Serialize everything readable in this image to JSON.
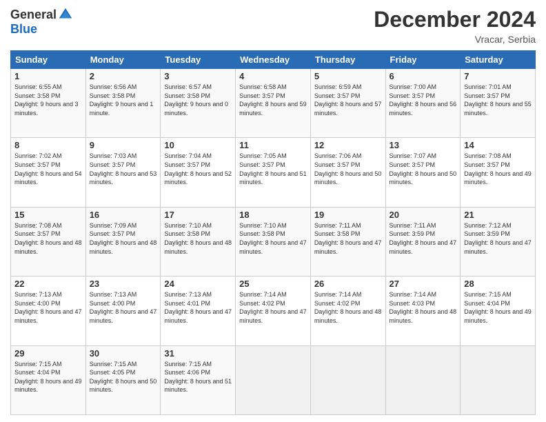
{
  "logo": {
    "general": "General",
    "blue": "Blue"
  },
  "header": {
    "month": "December 2024",
    "location": "Vracar, Serbia"
  },
  "weekdays": [
    "Sunday",
    "Monday",
    "Tuesday",
    "Wednesday",
    "Thursday",
    "Friday",
    "Saturday"
  ],
  "weeks": [
    [
      {
        "day": "1",
        "sunrise": "6:55 AM",
        "sunset": "3:58 PM",
        "daylight": "9 hours and 3 minutes."
      },
      {
        "day": "2",
        "sunrise": "6:56 AM",
        "sunset": "3:58 PM",
        "daylight": "9 hours and 1 minute."
      },
      {
        "day": "3",
        "sunrise": "6:57 AM",
        "sunset": "3:58 PM",
        "daylight": "9 hours and 0 minutes."
      },
      {
        "day": "4",
        "sunrise": "6:58 AM",
        "sunset": "3:57 PM",
        "daylight": "8 hours and 59 minutes."
      },
      {
        "day": "5",
        "sunrise": "6:59 AM",
        "sunset": "3:57 PM",
        "daylight": "8 hours and 57 minutes."
      },
      {
        "day": "6",
        "sunrise": "7:00 AM",
        "sunset": "3:57 PM",
        "daylight": "8 hours and 56 minutes."
      },
      {
        "day": "7",
        "sunrise": "7:01 AM",
        "sunset": "3:57 PM",
        "daylight": "8 hours and 55 minutes."
      }
    ],
    [
      {
        "day": "8",
        "sunrise": "7:02 AM",
        "sunset": "3:57 PM",
        "daylight": "8 hours and 54 minutes."
      },
      {
        "day": "9",
        "sunrise": "7:03 AM",
        "sunset": "3:57 PM",
        "daylight": "8 hours and 53 minutes."
      },
      {
        "day": "10",
        "sunrise": "7:04 AM",
        "sunset": "3:57 PM",
        "daylight": "8 hours and 52 minutes."
      },
      {
        "day": "11",
        "sunrise": "7:05 AM",
        "sunset": "3:57 PM",
        "daylight": "8 hours and 51 minutes."
      },
      {
        "day": "12",
        "sunrise": "7:06 AM",
        "sunset": "3:57 PM",
        "daylight": "8 hours and 50 minutes."
      },
      {
        "day": "13",
        "sunrise": "7:07 AM",
        "sunset": "3:57 PM",
        "daylight": "8 hours and 50 minutes."
      },
      {
        "day": "14",
        "sunrise": "7:08 AM",
        "sunset": "3:57 PM",
        "daylight": "8 hours and 49 minutes."
      }
    ],
    [
      {
        "day": "15",
        "sunrise": "7:08 AM",
        "sunset": "3:57 PM",
        "daylight": "8 hours and 48 minutes."
      },
      {
        "day": "16",
        "sunrise": "7:09 AM",
        "sunset": "3:57 PM",
        "daylight": "8 hours and 48 minutes."
      },
      {
        "day": "17",
        "sunrise": "7:10 AM",
        "sunset": "3:58 PM",
        "daylight": "8 hours and 48 minutes."
      },
      {
        "day": "18",
        "sunrise": "7:10 AM",
        "sunset": "3:58 PM",
        "daylight": "8 hours and 47 minutes."
      },
      {
        "day": "19",
        "sunrise": "7:11 AM",
        "sunset": "3:58 PM",
        "daylight": "8 hours and 47 minutes."
      },
      {
        "day": "20",
        "sunrise": "7:11 AM",
        "sunset": "3:59 PM",
        "daylight": "8 hours and 47 minutes."
      },
      {
        "day": "21",
        "sunrise": "7:12 AM",
        "sunset": "3:59 PM",
        "daylight": "8 hours and 47 minutes."
      }
    ],
    [
      {
        "day": "22",
        "sunrise": "7:13 AM",
        "sunset": "4:00 PM",
        "daylight": "8 hours and 47 minutes."
      },
      {
        "day": "23",
        "sunrise": "7:13 AM",
        "sunset": "4:00 PM",
        "daylight": "8 hours and 47 minutes."
      },
      {
        "day": "24",
        "sunrise": "7:13 AM",
        "sunset": "4:01 PM",
        "daylight": "8 hours and 47 minutes."
      },
      {
        "day": "25",
        "sunrise": "7:14 AM",
        "sunset": "4:02 PM",
        "daylight": "8 hours and 47 minutes."
      },
      {
        "day": "26",
        "sunrise": "7:14 AM",
        "sunset": "4:02 PM",
        "daylight": "8 hours and 48 minutes."
      },
      {
        "day": "27",
        "sunrise": "7:14 AM",
        "sunset": "4:03 PM",
        "daylight": "8 hours and 48 minutes."
      },
      {
        "day": "28",
        "sunrise": "7:15 AM",
        "sunset": "4:04 PM",
        "daylight": "8 hours and 49 minutes."
      }
    ],
    [
      {
        "day": "29",
        "sunrise": "7:15 AM",
        "sunset": "4:04 PM",
        "daylight": "8 hours and 49 minutes."
      },
      {
        "day": "30",
        "sunrise": "7:15 AM",
        "sunset": "4:05 PM",
        "daylight": "8 hours and 50 minutes."
      },
      {
        "day": "31",
        "sunrise": "7:15 AM",
        "sunset": "4:06 PM",
        "daylight": "8 hours and 51 minutes."
      },
      null,
      null,
      null,
      null
    ]
  ]
}
